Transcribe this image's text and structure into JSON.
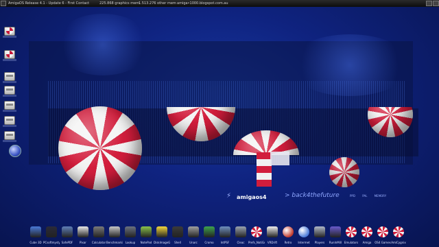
{
  "titlebar": {
    "title": "AmigaOS Release 4.1 - Update 6 - First Contact",
    "graphics_mem": "225.868 graphics mem",
    "other_mem": "1.513.276 other mem",
    "url": "amiga•1000.blogspot.com.au"
  },
  "desktop": {
    "left_icons": [
      "disk-boing",
      "disk-boing",
      "drive",
      "drive",
      "drive",
      "drive",
      "drive"
    ],
    "logo_text": "amigaos4",
    "tagline": "> back4thefuture",
    "mini_labels": [
      "PPD",
      "PAL",
      "MEMORY"
    ]
  },
  "dock": {
    "items": [
      {
        "label": "Cube 3D",
        "icon": "cube-icon",
        "color": "#4a7ad8"
      },
      {
        "label": "PCsoftmystyle",
        "icon": "monitor-icon",
        "color": "#2a2a3a"
      },
      {
        "label": "SafePDF",
        "icon": "pdf-icon",
        "color": "#5f7fb8"
      },
      {
        "label": "Pixar",
        "icon": "lamp-icon",
        "color": "#e8e8e8"
      },
      {
        "label": "Calculator",
        "icon": "calculator-icon",
        "color": "#7a7a7a"
      },
      {
        "label": "Benchmarking",
        "icon": "chart-icon",
        "color": "#c8c8c8"
      },
      {
        "label": "Lookup",
        "icon": "book-icon",
        "color": "#6b7280"
      },
      {
        "label": "NotePad",
        "icon": "notepad-icon",
        "color": "#8bc34a"
      },
      {
        "label": "DiskImageGUI",
        "icon": "disk-image-icon",
        "color": "#f5d83b"
      },
      {
        "label": "Shell",
        "icon": "shell-icon",
        "color": "#3b3b3b"
      },
      {
        "label": "Unarc",
        "icon": "archive-icon",
        "color": "#a0a0a0"
      },
      {
        "label": "Cromo",
        "icon": "recycle-icon",
        "color": "#3fa34d"
      },
      {
        "label": "IntPSF",
        "icon": "document-icon",
        "color": "#6f8fbf"
      },
      {
        "label": "Cleac",
        "icon": "trash-icon",
        "color": "#9aa3b0"
      },
      {
        "label": "Prefs_NotiGrowl & Co.",
        "icon": "boing-icon",
        "color": "#d21d3c"
      },
      {
        "label": "VRDrift",
        "icon": "flask-icon",
        "color": "#eeeeee"
      },
      {
        "label": "Retro",
        "icon": "globe-icon",
        "color": "#c0392b"
      },
      {
        "label": "Intermet",
        "icon": "globe-blue-icon",
        "color": "#4a7ad8"
      },
      {
        "label": "Players",
        "icon": "rocket-icon",
        "color": "#b0b8c8"
      },
      {
        "label": "RunInMill",
        "icon": "windmill-icon",
        "color": "#6a5acd"
      },
      {
        "label": "Emulators",
        "icon": "boing-icon",
        "color": "#d21d3c"
      },
      {
        "label": "Amiga",
        "icon": "boing-icon",
        "color": "#d21d3c"
      },
      {
        "label": "OS4 Games",
        "icon": "boing-icon",
        "color": "#d21d3c"
      },
      {
        "label": "AmiCygnix",
        "icon": "boing-icon",
        "color": "#d21d3c"
      }
    ]
  }
}
